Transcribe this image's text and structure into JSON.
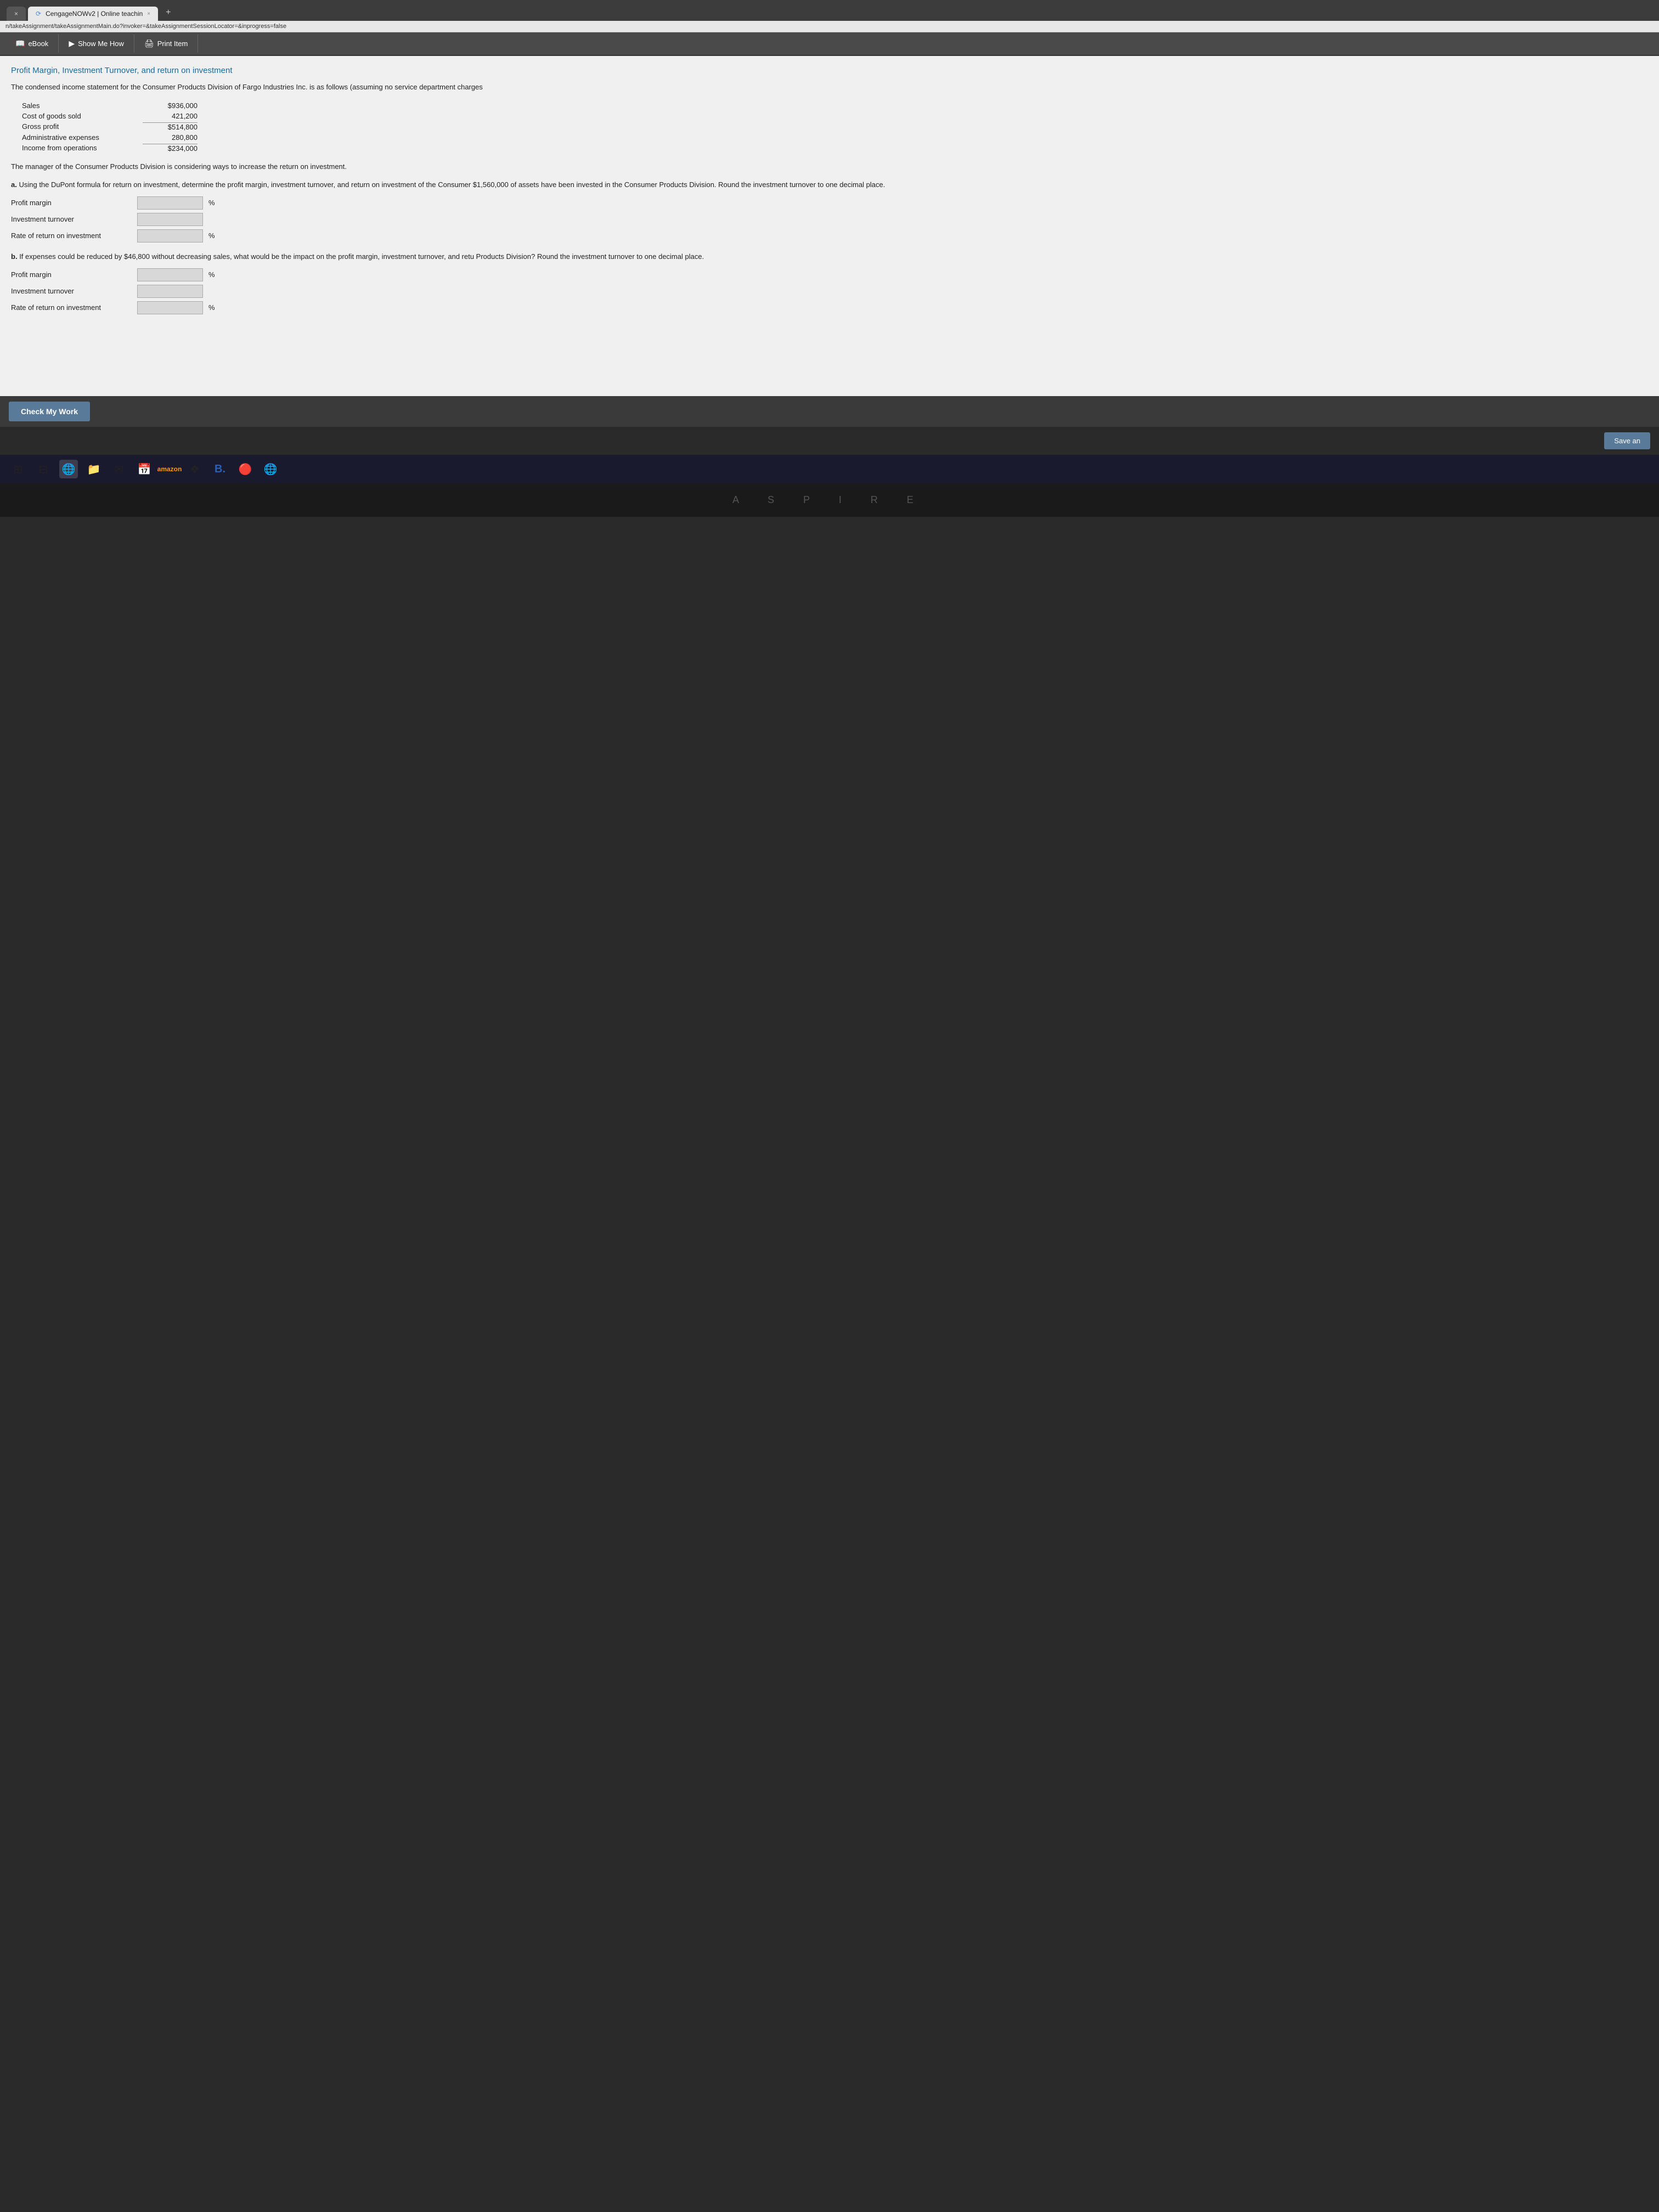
{
  "browser": {
    "tab_inactive": "×",
    "tab_active_icon": "⟳",
    "tab_active_label": "CengageNOWv2 | Online teachin",
    "tab_close": "×",
    "tab_new": "+",
    "address": "n/takeAssignment/takeAssignmentMain.do?invoker=&takeAssignmentSessionLocator=&inprogress=false"
  },
  "toolbar": {
    "ebook_label": "eBook",
    "show_me_how_label": "Show Me How",
    "print_item_label": "Print Item"
  },
  "page": {
    "title": "Profit Margin, Investment Turnover, and return on investment",
    "intro": "The condensed income statement for the Consumer Products Division of Fargo Industries Inc. is as follows (assuming no service department charges",
    "financial_data": [
      {
        "label": "Sales",
        "value": "$936,000",
        "type": "dollar"
      },
      {
        "label": "Cost of goods sold",
        "value": "421,200",
        "type": "plain"
      },
      {
        "label": "Gross profit",
        "value": "$514,800",
        "type": "dollar"
      },
      {
        "label": "Administrative expenses",
        "value": "280,800",
        "type": "plain"
      },
      {
        "label": "Income from operations",
        "value": "$234,000",
        "type": "dollar"
      }
    ],
    "manager_text": "The manager of the Consumer Products Division is considering ways to increase the return on investment.",
    "question_a": {
      "label_bold": "a.",
      "label_text": " Using the DuPont formula for return on investment, determine the profit margin, investment turnover, and return on investment of the Consumer $1,560,000 of assets have been invested in the Consumer Products Division. Round the investment turnover to one decimal place.",
      "inputs": [
        {
          "label": "Profit margin",
          "suffix": "%"
        },
        {
          "label": "Investment turnover",
          "suffix": ""
        },
        {
          "label": "Rate of return on investment",
          "suffix": "%"
        }
      ]
    },
    "question_b": {
      "label_bold": "b.",
      "label_text": " If expenses could be reduced by $46,800 without decreasing sales, what would be the impact on the profit margin, investment turnover, and retu Products Division? Round the investment turnover to one decimal place.",
      "inputs": [
        {
          "label": "Profit margin",
          "suffix": "%"
        },
        {
          "label": "Investment turnover",
          "suffix": ""
        },
        {
          "label": "Rate of return on investment",
          "suffix": "%"
        }
      ]
    }
  },
  "buttons": {
    "check_my_work": "Check My Work",
    "save_and": "Save an"
  },
  "taskbar": {
    "icons": [
      "⊞",
      "⊟",
      "🌐",
      "📁",
      "✉",
      "📅",
      "🛒",
      "❖",
      "B",
      "🔴",
      "🌐"
    ]
  },
  "keyboard": {
    "keys": "A  S  P  I  R  E"
  }
}
